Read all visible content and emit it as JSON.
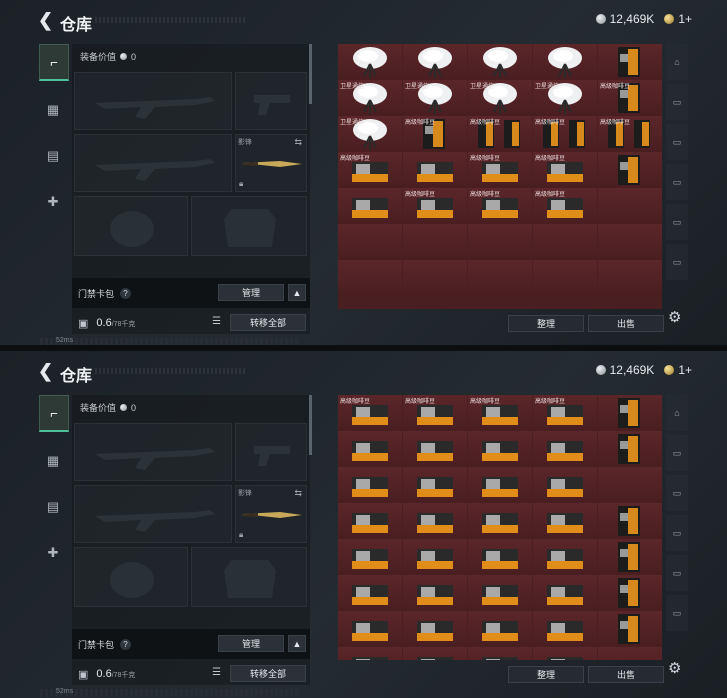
{
  "header": {
    "title": "仓库",
    "currency": "12,469K",
    "tickets": "1+"
  },
  "equipment": {
    "label": "装备价值",
    "value": "0",
    "slot_shadow_label": "影锋",
    "card_label": "门禁卡包",
    "manage_label": "管理",
    "capacity": "0.6",
    "capacity_max": "/78千克",
    "transfer_label": "转移全部"
  },
  "grid_buttons": {
    "organize": "整理",
    "sell": "出售"
  },
  "status": {
    "ping": "52ms"
  },
  "colors": {
    "accent": "#4cc19a",
    "grid_bg": "#4a1f22"
  },
  "screens": [
    {
      "rows": [
        [
          "",
          "",
          "",
          "",
          ""
        ],
        [
          "卫星通信",
          "卫星通信",
          "卫星通信",
          "卫星通信",
          "高级咖啡豆"
        ],
        [
          "卫星通信",
          "高级咖啡豆",
          "高级咖啡豆",
          "高级咖啡豆",
          "高级咖啡豆"
        ],
        [
          "高级咖啡豆",
          "",
          "高级咖啡豆",
          "高级咖啡豆",
          ""
        ],
        [
          "",
          "高级咖啡豆",
          "高级咖啡豆",
          "高级咖啡豆",
          ""
        ],
        [
          "",
          "",
          "",
          "",
          ""
        ],
        [
          "",
          "",
          "",
          "",
          ""
        ]
      ],
      "icons": [
        [
          "dish",
          "dish",
          "dish",
          "dish",
          "bag"
        ],
        [
          "dish",
          "dish",
          "dish",
          "dish",
          "bag"
        ],
        [
          "dish",
          "bag",
          "bag2",
          "bag2",
          "bag2"
        ],
        [
          "box",
          "box",
          "box",
          "box",
          "bag"
        ],
        [
          "box",
          "box",
          "box",
          "box",
          ""
        ],
        [
          "",
          "",
          "",
          "",
          ""
        ],
        [
          "",
          "",
          "",
          "",
          ""
        ]
      ]
    },
    {
      "rows": [
        [
          "高级咖啡豆",
          "高级咖啡豆",
          "高级咖啡豆",
          "高级咖啡豆",
          ""
        ],
        [
          "",
          "",
          "",
          "",
          ""
        ],
        [
          "",
          "",
          "",
          "",
          ""
        ],
        [
          "",
          "",
          "",
          "",
          ""
        ],
        [
          "",
          "",
          "",
          "",
          ""
        ],
        [
          "",
          "",
          "",
          "",
          ""
        ],
        [
          "",
          "",
          "",
          "",
          ""
        ],
        [
          "",
          "",
          "",
          "",
          ""
        ]
      ],
      "icons": [
        [
          "box",
          "box",
          "box",
          "box",
          "bag"
        ],
        [
          "box",
          "box",
          "box",
          "box",
          "bag"
        ],
        [
          "box",
          "box",
          "box",
          "box",
          ""
        ],
        [
          "box",
          "box",
          "box",
          "box",
          "bag"
        ],
        [
          "box",
          "box",
          "box",
          "box",
          "bag"
        ],
        [
          "box",
          "box",
          "box",
          "box",
          "bag"
        ],
        [
          "box",
          "box",
          "box",
          "box",
          "bag"
        ],
        [
          "box",
          "box",
          "box",
          "box",
          ""
        ]
      ]
    }
  ]
}
